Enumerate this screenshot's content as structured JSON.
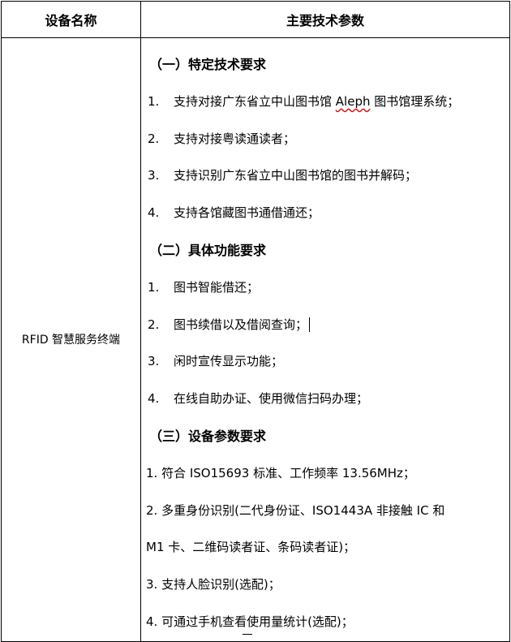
{
  "table": {
    "header_name": "设备名称",
    "header_params": "主要技术参数",
    "device_name": "RFID 智慧服务终端"
  },
  "sections": {
    "s1_title": "（一）特定技术要求",
    "s1_items": [
      {
        "num": "1.",
        "pre": "支持对接广东省立中山图书馆 ",
        "aleph": "Aleph",
        "post": " 图书馆理系统；"
      },
      {
        "num": "2.",
        "text": "支持对接粤读通读者；"
      },
      {
        "num": "3.",
        "text": "支持识别广东省立中山图书馆的图书并解码；"
      },
      {
        "num": "4.",
        "text": "支持各馆藏图书通借通还；"
      }
    ],
    "s2_title": "（二）具体功能要求",
    "s2_items": [
      {
        "num": "1.",
        "text": "图书智能借还；"
      },
      {
        "num": "2.",
        "text": "图书续借以及借阅查询；"
      },
      {
        "num": "3.",
        "text": "闲时宣传显示功能；"
      },
      {
        "num": "4.",
        "text": "在线自助办证、使用微信扫码办理；"
      }
    ],
    "s3_title": "（三）设备参数要求",
    "s3_items": [
      {
        "text": "1. 符合  ISO15693  标准、工作频率  13.56MHz；"
      },
      {
        "text_a": "2. 多重身份识别(二代身份证、ISO1443A  非接触  IC  和",
        "text_b": "M1  卡、二维码读者证、条码读者证)；"
      },
      {
        "text": "3. 支持人脸识别(选配)；"
      },
      {
        "text": "4. 可通过手机查看使用量统计(选配)；"
      }
    ]
  }
}
